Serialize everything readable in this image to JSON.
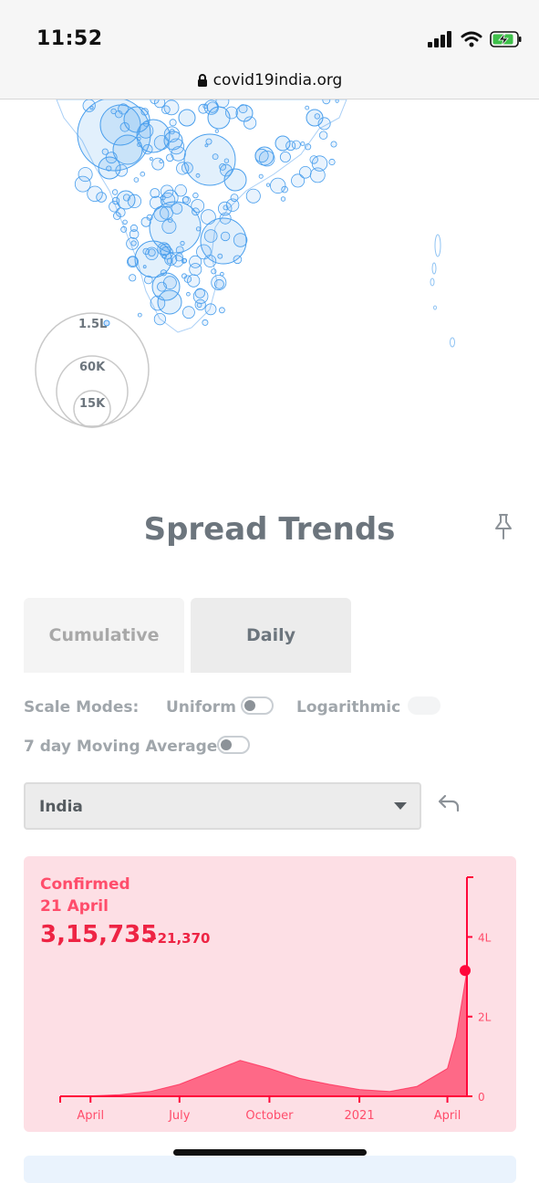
{
  "status_bar": {
    "time": "11:52"
  },
  "browser": {
    "url": "covid19india.org"
  },
  "map_legend": {
    "large": "1.5L",
    "medium": "60K",
    "small": "15K"
  },
  "section": {
    "title": "Spread Trends"
  },
  "tabs": [
    {
      "label": "Cumulative",
      "active": false
    },
    {
      "label": "Daily",
      "active": true
    }
  ],
  "options": {
    "scale_modes_label": "Scale Modes:",
    "uniform_label": "Uniform",
    "uniform_on": false,
    "logarithmic_label": "Logarithmic",
    "logarithmic_on": false,
    "moving_average_label": "7 day Moving Average",
    "moving_average_on": false
  },
  "region_select": {
    "value": "India"
  },
  "colors": {
    "confirmed": "#ff073a",
    "card_bg": "#fddfe5",
    "map_bubble": "#4a9fed"
  },
  "chart_data": {
    "type": "area",
    "series": [
      {
        "name": "Confirmed"
      }
    ],
    "label_title": "Confirmed",
    "label_date": "21 April",
    "label_value": "3,15,735",
    "label_delta": "+21,370",
    "x_ticks": [
      "April",
      "July",
      "October",
      "2021",
      "April"
    ],
    "y_ticks": [
      "0",
      "2L",
      "4L"
    ],
    "ylim": [
      0,
      550000
    ],
    "x": [
      "2020-03",
      "2020-04",
      "2020-05",
      "2020-06",
      "2020-07",
      "2020-08",
      "2020-09",
      "2020-10",
      "2020-11",
      "2020-12",
      "2021-01",
      "2021-02",
      "2021-03",
      "2021-04-01",
      "2021-04-10",
      "2021-04-21"
    ],
    "y": [
      50,
      1000,
      4000,
      12000,
      30000,
      60000,
      90000,
      70000,
      45000,
      30000,
      17000,
      12000,
      25000,
      70000,
      150000,
      315735
    ]
  }
}
